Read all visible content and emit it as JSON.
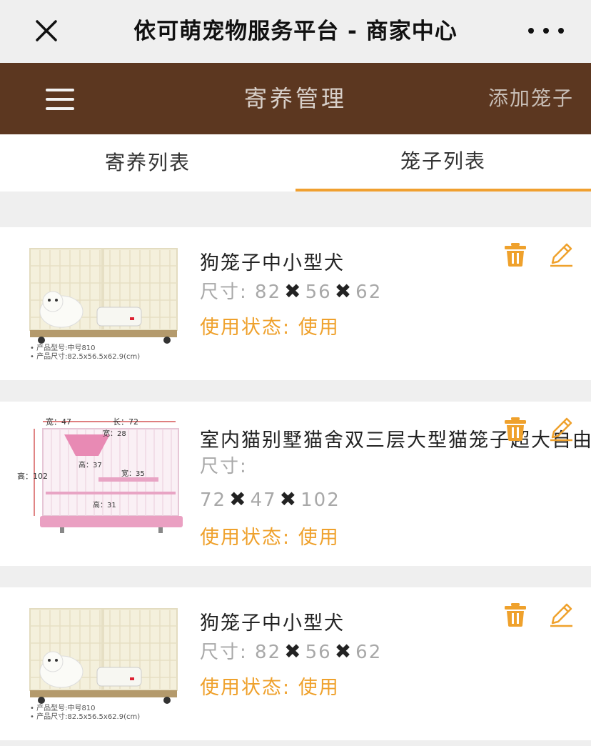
{
  "wx": {
    "title": "依可萌宠物服务平台 - 商家中心"
  },
  "header": {
    "title": "寄养管理",
    "action": "添加笼子"
  },
  "tabs": [
    {
      "label": "寄养列表"
    },
    {
      "label": "笼子列表"
    }
  ],
  "colors": {
    "brand": "#5c3720",
    "accent": "#f0a030",
    "status": "#efa12c"
  },
  "cages": [
    {
      "name": "狗笼子中小型犬",
      "size_label": "尺寸:",
      "length": "82",
      "width": "56",
      "height": "62",
      "times": "✖",
      "status_label": "使用状态:",
      "status": "使用",
      "image": {
        "kind": "dog-cage",
        "caption_model": "• 产品型号:中号810",
        "caption_size": "• 产品尺寸:82.5x56.5x62.9(cm)"
      }
    },
    {
      "name": "室内猫别墅猫舍双三层大型猫笼子超大自由",
      "size_label": "尺寸:",
      "length": "72",
      "width": "47",
      "height": "102",
      "times": "✖",
      "status_label": "使用状态:",
      "status": "使用",
      "image": {
        "kind": "cat-villa",
        "dim_width": "宽：47",
        "dim_length": "长：72",
        "dim_inner_width": "宽：28",
        "dim_height": "高：102",
        "dim_height_mid": "高：37",
        "dim_inner_width2": "宽：35",
        "dim_height_low": "高：31"
      }
    },
    {
      "name": "狗笼子中小型犬",
      "size_label": "尺寸:",
      "length": "82",
      "width": "56",
      "height": "62",
      "times": "✖",
      "status_label": "使用状态:",
      "status": "使用",
      "image": {
        "kind": "dog-cage",
        "caption_model": "• 产品型号:中号810",
        "caption_size": "• 产品尺寸:82.5x56.5x62.9(cm)"
      }
    }
  ]
}
